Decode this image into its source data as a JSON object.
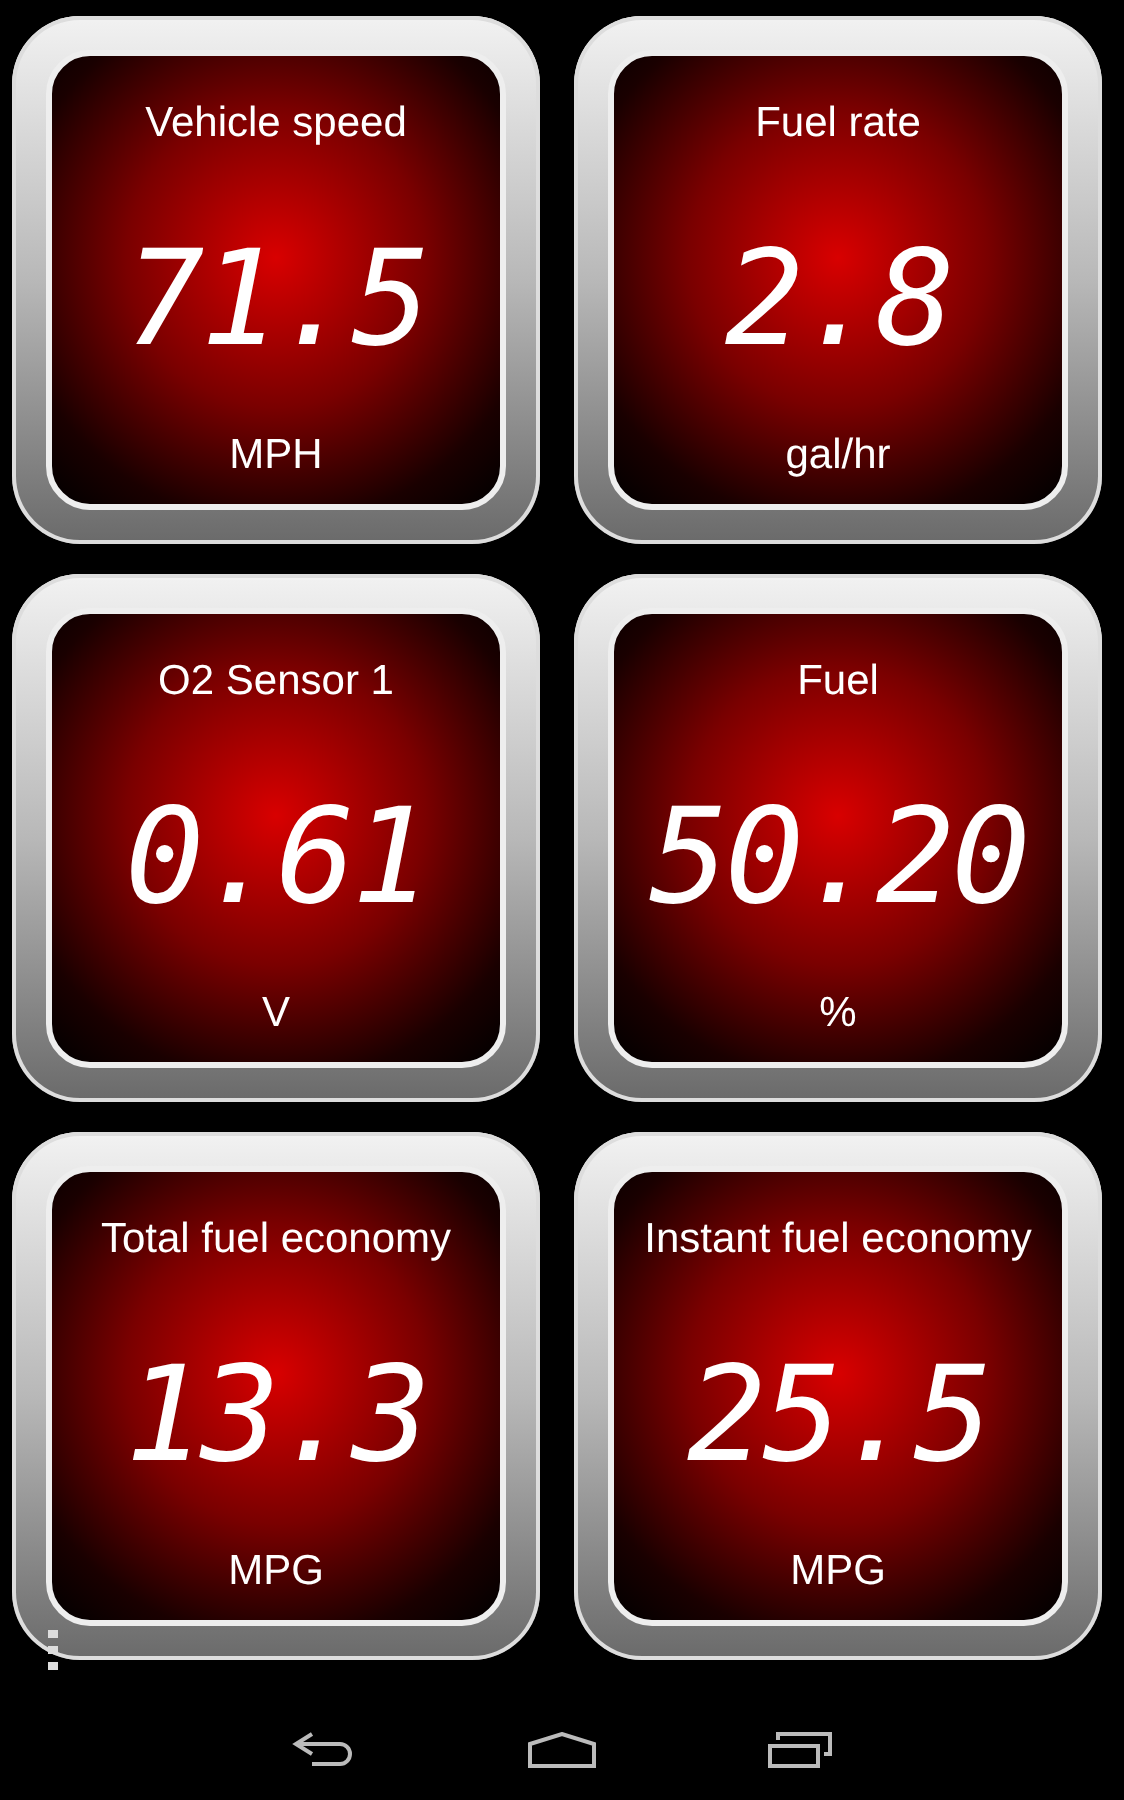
{
  "gauges": [
    {
      "label": "Vehicle speed",
      "value": "71.5",
      "unit": "MPH"
    },
    {
      "label": "Fuel rate",
      "value": "2.8",
      "unit": "gal/hr"
    },
    {
      "label": "O2 Sensor 1",
      "value": "0.61",
      "unit": "V"
    },
    {
      "label": "Fuel",
      "value": "50.20",
      "unit": "%"
    },
    {
      "label": "Total fuel economy",
      "value": "13.3",
      "unit": "MPG"
    },
    {
      "label": "Instant fuel economy",
      "value": "25.5",
      "unit": "MPG"
    }
  ]
}
